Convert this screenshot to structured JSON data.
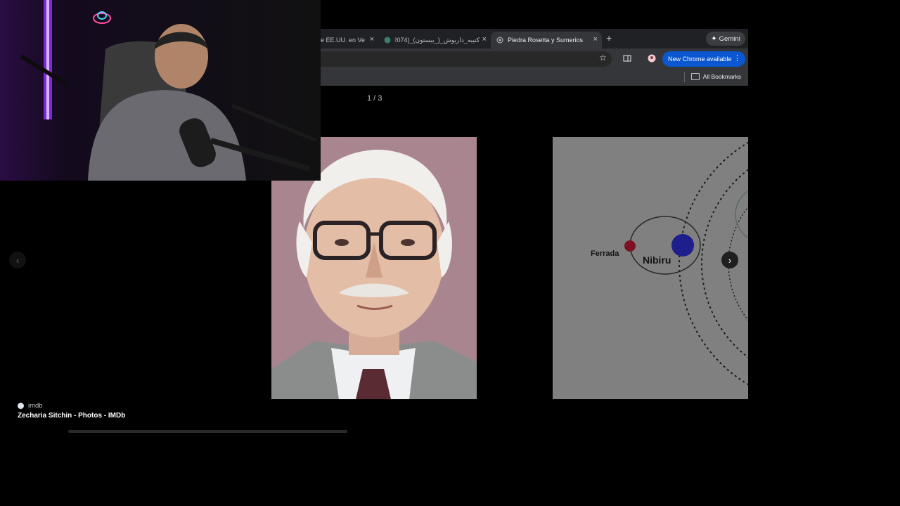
{
  "browser": {
    "tabs": [
      {
        "label": "e EE.UU. en Ve"
      },
      {
        "label": "کتیبه_داریوش_(_بیستون)_(2074"
      },
      {
        "label": "Piedra Rosetta y Sumerios"
      }
    ],
    "gemini_label": "Gemini",
    "update_label": "New Chrome available",
    "bookmarks_label": "All Bookmarks"
  },
  "viewer": {
    "counter": "1 / 3",
    "source_name": "imdb",
    "caption": "Zecharia Sitchin - Photos - IMDb"
  },
  "diagram": {
    "label_ferrada": "Ferrada",
    "label_nibiru": "Nibiru"
  },
  "icons": {
    "close": "close-icon",
    "new_tab": "plus-icon",
    "star": "star-icon",
    "prev": "chevron-left-icon",
    "next": "chevron-right-icon"
  },
  "colors": {
    "update_chip": "#0b57d0",
    "nibiru_planet": "#1e1e8c",
    "ferrada_planet": "#7a1222",
    "webcam_neon": "#8a2be2"
  }
}
